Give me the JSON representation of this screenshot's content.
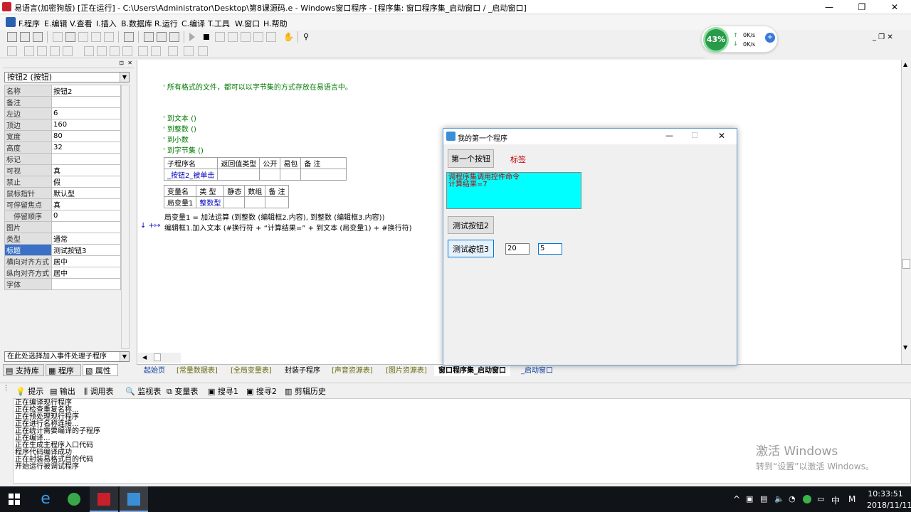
{
  "titlebar": {
    "title": "易语言(加密狗版) [正在运行] - C:\\Users\\Administrator\\Desktop\\第8课源码.e - Windows窗口程序 - [程序集: 窗口程序集_启动窗口 / _启动窗口]",
    "minimize": "—",
    "maximize": "❐",
    "close": "✕"
  },
  "menu": [
    "F.程序",
    "E.编辑",
    "V.查看",
    "I.插入",
    "B.数据库",
    "R.运行",
    "C.编译",
    "T.工具",
    "W.窗口",
    "H.帮助"
  ],
  "mdi_controls": "_ ❐ ✕",
  "net_widget": {
    "percent": "43%",
    "up": "0K/s",
    "down": "0K/s"
  },
  "left_panel": {
    "object_select": "按钮2 (按钮)",
    "properties": [
      {
        "k": "名称",
        "v": "按钮2"
      },
      {
        "k": "备注",
        "v": ""
      },
      {
        "k": "左边",
        "v": "6"
      },
      {
        "k": "顶边",
        "v": "160"
      },
      {
        "k": "宽度",
        "v": "80"
      },
      {
        "k": "高度",
        "v": "32"
      },
      {
        "k": "标记",
        "v": ""
      },
      {
        "k": "可视",
        "v": "真"
      },
      {
        "k": "禁止",
        "v": "假"
      },
      {
        "k": "鼠标指针",
        "v": "默认型"
      },
      {
        "k": "可停留焦点",
        "v": "真"
      },
      {
        "k": "停留顺序",
        "v": "0"
      },
      {
        "k": "图片",
        "v": ""
      },
      {
        "k": "类型",
        "v": "通常"
      },
      {
        "k": "标题",
        "v": "测试按钮3"
      },
      {
        "k": "横向对齐方式",
        "v": "居中"
      },
      {
        "k": "纵向对齐方式",
        "v": "居中"
      },
      {
        "k": "字体",
        "v": ""
      }
    ],
    "event_select": "在此处选择加入事件处理子程序",
    "tabs": [
      "支持库",
      "程序",
      "属性"
    ]
  },
  "code": {
    "comment_main": "' 所有格式的文件，都可以以字节集的方式存放在易语言中。",
    "comments": [
      "' 到文本 ()",
      "' 到整数 ()",
      "' 到小数",
      "' 到字节集 ()"
    ],
    "sub_header": [
      "子程序名",
      "返回值类型",
      "公开",
      "易包",
      "备 注"
    ],
    "sub_row": [
      "_按钮2_被单击",
      "",
      "",
      "",
      ""
    ],
    "var_header": [
      "变量名",
      "类 型",
      "静态",
      "数组",
      "备 注"
    ],
    "var_row": [
      "局变量1",
      "整数型",
      "",
      "",
      ""
    ],
    "line1": "局变量1 = 加法运算 (到整数 (编辑框2.内容), 到整数 (编辑框3.内容))",
    "line2_marker": "↓ +↦",
    "line2": "编辑框1.加入文本 (#换行符 + “计算结果=” + 到文本 (局变量1) + #换行符)"
  },
  "editor_tabs": [
    "起始页",
    "[常量数据表]",
    "[全局变量表]",
    "封装子程序",
    "[声音资源表]",
    "[图片资源表]",
    "窗口程序集_启动窗口",
    "_启动窗口"
  ],
  "output_tabs": [
    "提示",
    "输出",
    "调用表",
    "监视表",
    "变量表",
    "搜寻1",
    "搜寻2",
    "剪辑历史"
  ],
  "output_lines": [
    "正在编译现行程序",
    "正在检查重复名称...",
    "正在预处理现行程序",
    "正在进行名称连接...",
    "正在统计需要编译的子程序",
    "正在编译...",
    "正在生成主程序入口代码",
    "程序代码编译成功",
    "正在封装易格式目的代码",
    "开始运行被调试程序"
  ],
  "watermark": {
    "line1": "激活 Windows",
    "line2": "转到“设置”以激活 Windows。"
  },
  "app_window": {
    "title": "我的第一个程序",
    "button1": "第一个按钮",
    "label": "标签",
    "textbox_lines": [
      "调程序集调用控件命令",
      "计算结果=7"
    ],
    "button2": "测试按钮2",
    "button3": "测试按钮3",
    "input1": "20",
    "input2": "5"
  },
  "taskbar": {
    "ime": "中",
    "time": "10:33:51",
    "date": "2018/11/11"
  },
  "colors": {
    "accent": "#0078d7",
    "cyan": "#00ffff",
    "comment": "#007a00",
    "keyword_red": "#c00000"
  }
}
